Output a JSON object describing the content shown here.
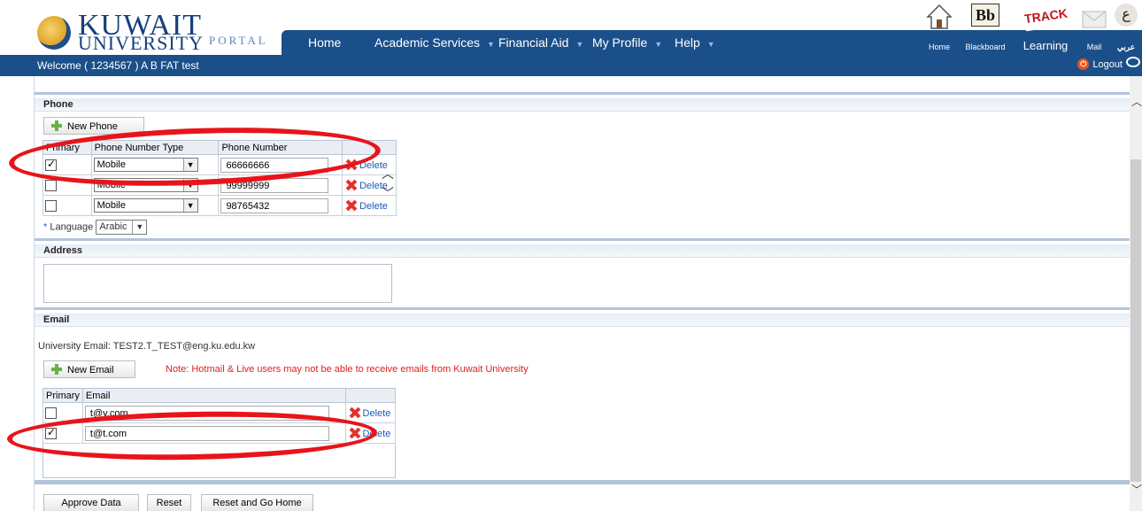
{
  "header": {
    "logo_main": "KUWAIT",
    "logo_sub": "UNIVERSITY",
    "logo_portal": "PORTAL",
    "nav": [
      {
        "label": "Home",
        "dropdown": false
      },
      {
        "label": "Academic Services",
        "dropdown": true
      },
      {
        "label": "Financial Aid",
        "dropdown": true
      },
      {
        "label": "My Profile",
        "dropdown": true
      },
      {
        "label": "Help",
        "dropdown": true
      }
    ],
    "icons": {
      "home": "Home",
      "blackboard": "Blackboard",
      "learning": "Learning",
      "mail": "Mail",
      "arabic": "عربي",
      "bb_text": "Bb",
      "track_text": "TRACK",
      "arabic_glyph": "ع"
    }
  },
  "welcome_bar": {
    "text": "Welcome ( 1234567 ) A B FAT test",
    "logout_label": "Logout"
  },
  "phone": {
    "title": "Phone",
    "new_button": "New Phone",
    "columns": [
      "Primary",
      "Phone Number Type",
      "Phone Number"
    ],
    "rows": [
      {
        "primary": true,
        "type": "Mobile",
        "number": "66666666",
        "delete": "Delete"
      },
      {
        "primary": false,
        "type": "Mobile",
        "number": "99999999",
        "delete": "Delete"
      },
      {
        "primary": false,
        "type": "Mobile",
        "number": "98765432",
        "delete": "Delete"
      }
    ],
    "language_label": "Language",
    "language_value": "Arabic"
  },
  "address": {
    "title": "Address"
  },
  "email": {
    "title": "Email",
    "university_email_label": "University Email:",
    "university_email": "TEST2.T_TEST@eng.ku.edu.kw",
    "new_button": "New Email",
    "note": "Note: Hotmail & Live users may not be able to receive emails from Kuwait University",
    "columns": [
      "Primary",
      "Email"
    ],
    "rows": [
      {
        "primary": false,
        "email": "t@y.com",
        "delete": "Delete"
      },
      {
        "primary": true,
        "email": "t@t.com",
        "delete": "Delete"
      }
    ]
  },
  "actions": {
    "approve": "Approve Data",
    "reset": "Reset",
    "reset_home": "Reset and Go Home"
  },
  "colors": {
    "nav_bg": "#1b4f8a",
    "annotation_ring": "#e8141b",
    "note_red": "#e02020"
  }
}
